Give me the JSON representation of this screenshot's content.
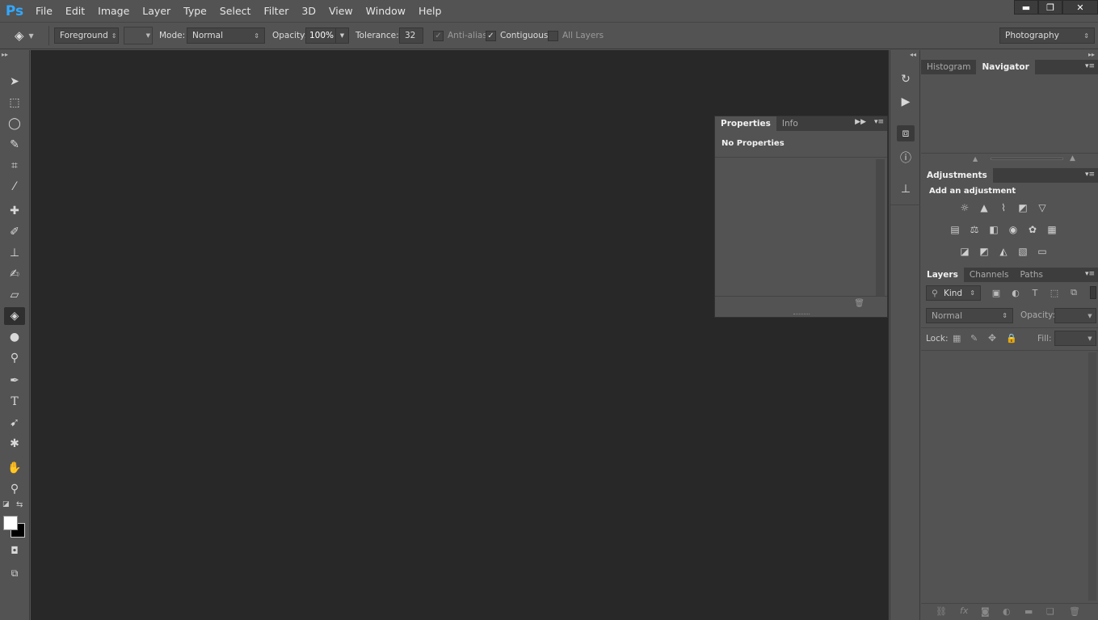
{
  "app": {
    "logo": "Ps"
  },
  "menu": [
    "File",
    "Edit",
    "Image",
    "Layer",
    "Type",
    "Select",
    "Filter",
    "3D",
    "View",
    "Window",
    "Help"
  ],
  "window_controls": {
    "minimize": "▬",
    "restore": "❐",
    "close": "✕"
  },
  "options": {
    "tool_icon": "paint-bucket-icon",
    "fill_source": "Foreground",
    "mode_label": "Mode:",
    "mode_value": "Normal",
    "opacity_label": "Opacity:",
    "opacity_value": "100%",
    "tolerance_label": "Tolerance:",
    "tolerance_value": "32",
    "antialias_label": "Anti-alias",
    "antialias_checked": true,
    "contiguous_label": "Contiguous",
    "contiguous_checked": true,
    "all_layers_label": "All Layers",
    "all_layers_checked": false,
    "workspace": "Photography"
  },
  "toolbar": {
    "tools": [
      {
        "name": "move-tool-icon",
        "glyph": "➤"
      },
      {
        "name": "rectangular-marquee-icon",
        "glyph": "⬚"
      },
      {
        "name": "lasso-icon",
        "glyph": "◯"
      },
      {
        "name": "quick-selection-icon",
        "glyph": "✎"
      },
      {
        "name": "crop-icon",
        "glyph": "⌗"
      },
      {
        "name": "eyedropper-icon",
        "glyph": "⁄"
      },
      {
        "name": "spot-healing-icon",
        "glyph": "✚"
      },
      {
        "name": "brush-icon",
        "glyph": "✐"
      },
      {
        "name": "clone-stamp-icon",
        "glyph": "⊥"
      },
      {
        "name": "history-brush-icon",
        "glyph": "✍"
      },
      {
        "name": "eraser-icon",
        "glyph": "▱"
      },
      {
        "name": "paint-bucket-icon",
        "glyph": "◈"
      },
      {
        "name": "blur-icon",
        "glyph": "●"
      },
      {
        "name": "dodge-icon",
        "glyph": "⚲"
      },
      {
        "name": "pen-icon",
        "glyph": "✒"
      },
      {
        "name": "type-icon",
        "glyph": "T"
      },
      {
        "name": "path-selection-icon",
        "glyph": "➹"
      },
      {
        "name": "custom-shape-icon",
        "glyph": "✱"
      },
      {
        "name": "hand-icon",
        "glyph": "✋"
      },
      {
        "name": "zoom-icon",
        "glyph": "⚲"
      }
    ],
    "foreground_color": "#ffffff",
    "background_color": "#000000"
  },
  "properties_panel": {
    "tabs": [
      "Properties",
      "Info"
    ],
    "active_tab": "Properties",
    "message": "No Properties"
  },
  "right_dock": {
    "top_tabs": [
      "Histogram",
      "Navigator"
    ],
    "adjustments_tab": "Adjustments",
    "adjustments_heading": "Add an adjustment",
    "layers_tabs": [
      "Layers",
      "Channels",
      "Paths"
    ],
    "filter_kind": "Kind",
    "blend_mode": "Normal",
    "opacity_label": "Opacity:",
    "lock_label": "Lock:",
    "fill_label": "Fill:"
  },
  "colors": {
    "accent": "#31a8ff",
    "canvas": "#282828",
    "panel": "#535353"
  }
}
